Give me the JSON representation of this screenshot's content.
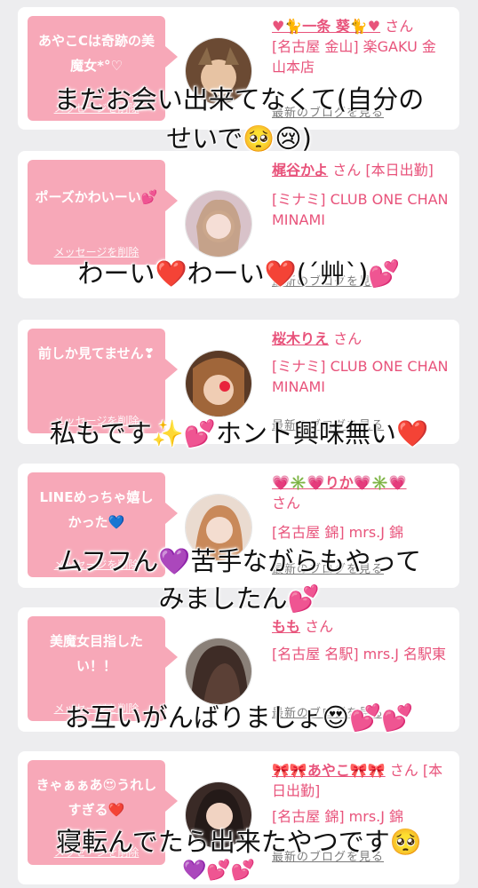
{
  "cards": [
    {
      "message": "あやこCは奇跡の美魔女*°♡",
      "delete_label": "メッセージを削除",
      "name": "♥🐈一条 葵🐈♥",
      "suffix": "さん",
      "tag": "",
      "shop": "[名古屋 金山] 楽GAKU 金山本店",
      "blog_link": "最新のブログを見る",
      "avatar_color": "#6b4a33"
    },
    {
      "message": "ポーズかわいーい💕",
      "delete_label": "メッセージを削除",
      "name": "梶谷かよ",
      "suffix": "さん",
      "tag": "[本日出勤]",
      "shop": "[ミナミ] CLUB ONE CHAN MINAMI",
      "blog_link": "最新のブログを見る",
      "avatar_color": "#c9a7b4"
    },
    {
      "message": "前しか見てません❣",
      "delete_label": "メッセージを削除",
      "name": "桜木りえ",
      "suffix": "さん",
      "tag": "",
      "shop": "[ミナミ] CLUB ONE CHAN MINAMI",
      "blog_link": "最新のブログを見る",
      "avatar_color": "#7a4a2c"
    },
    {
      "message": "LINEめっちゃ嬉しかった💙",
      "delete_label": "メッセージを削除",
      "name": "💗✳️💗りか💗✳️💗",
      "suffix": "さん",
      "tag": "",
      "shop": "[名古屋 錦] mrs.J 錦",
      "blog_link": "最新のブログを見る",
      "avatar_color": "#d9b7a0"
    },
    {
      "message": "美魔女目指したい！！",
      "delete_label": "メッセージを削除",
      "name": "もも",
      "suffix": "さん",
      "tag": "",
      "shop": "[名古屋 名駅] mrs.J 名駅東",
      "blog_link": "最新のブログを見る",
      "avatar_color": "#4a3a34"
    },
    {
      "message": "きゃぁぁあ😍うれしすぎる❤️",
      "delete_label": "メッセージを削除",
      "name": "🎀🎀あやこ🎀🎀",
      "suffix": "さん",
      "tag": "[本日出勤]",
      "shop": "[名古屋 錦] mrs.J 錦",
      "blog_link": "最新のブログを見る",
      "avatar_color": "#3a2a26"
    }
  ],
  "overlays": [
    "まだお会い出来てなくて(自分の",
    "せいで🥺😢)",
    "わーい❤️わーい❤️(´艸`)💕",
    "私もです✨💕ホント興味無い❤️",
    "ムフフん💜苦手ながらもやって",
    "みましたん💕",
    "お互いがんばりましょ😍💕💕",
    "寝転んでたら出来たやつです🥺"
  ],
  "bottom_emojis": "💜💕💕"
}
